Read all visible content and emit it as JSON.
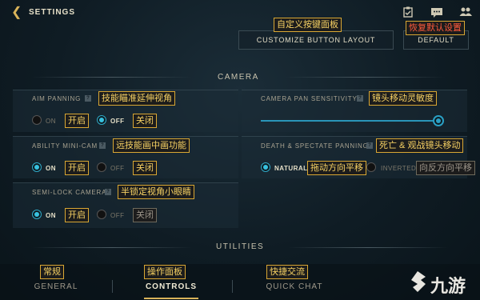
{
  "header": {
    "title": "SETTINGS",
    "icons": [
      "clipboard-icon",
      "chat-icon",
      "friends-icon"
    ]
  },
  "top_buttons": {
    "customize_label": "CUSTOMIZE BUTTON LAYOUT",
    "customize_note": "自定义按键面板",
    "default_label": "DEFAULT",
    "default_note": "恢复默认设置"
  },
  "camera": {
    "section_title": "CAMERA",
    "aim_panning": {
      "label": "AIM PANNING",
      "note": "技能瞄准延伸视角",
      "on_label": "ON",
      "on_note": "开启",
      "off_label": "OFF",
      "off_note": "关闭",
      "selected": "off"
    },
    "camera_pan_sensitivity": {
      "label": "CAMERA PAN SENSITIVITY",
      "note": "镜头移动灵敏度",
      "value": 1.0
    },
    "ability_minicam": {
      "label": "ABILITY MINI-CAM",
      "note": "远技能画中画功能",
      "on_label": "ON",
      "on_note": "开启",
      "off_label": "OFF",
      "off_note": "关闭",
      "selected": "on"
    },
    "death_spectate_panning": {
      "label": "DEATH & SPECTATE PANNING",
      "note": "死亡 & 观战镜头移动",
      "natural_label": "NATURAL",
      "natural_note": "拖动方向平移",
      "inverted_label": "INVERTED",
      "inverted_note": "向反方向平移",
      "selected": "natural"
    },
    "semilock_camera": {
      "label": "SEMI-LOCK CAMERA",
      "note": "半锁定视角小眼睛",
      "on_label": "ON",
      "on_note": "开启",
      "off_label": "OFF",
      "off_note": "关闭",
      "selected": "on"
    }
  },
  "utilities": {
    "section_title": "UTILITIES"
  },
  "tabs": [
    {
      "label": "GENERAL",
      "note": "常规",
      "active": false
    },
    {
      "label": "CONTROLS",
      "note": "操作面板",
      "active": true
    },
    {
      "label": "QUICK CHAT",
      "note": "快捷交流",
      "active": false
    }
  ],
  "watermark": {
    "text": "九游"
  },
  "colors": {
    "accent": "#d9b45a",
    "radio_on": "#38c2e0",
    "annotation_border": "#d9a733",
    "annotation_text": "#f5d063",
    "annotation_red": "#ff5a3c"
  }
}
